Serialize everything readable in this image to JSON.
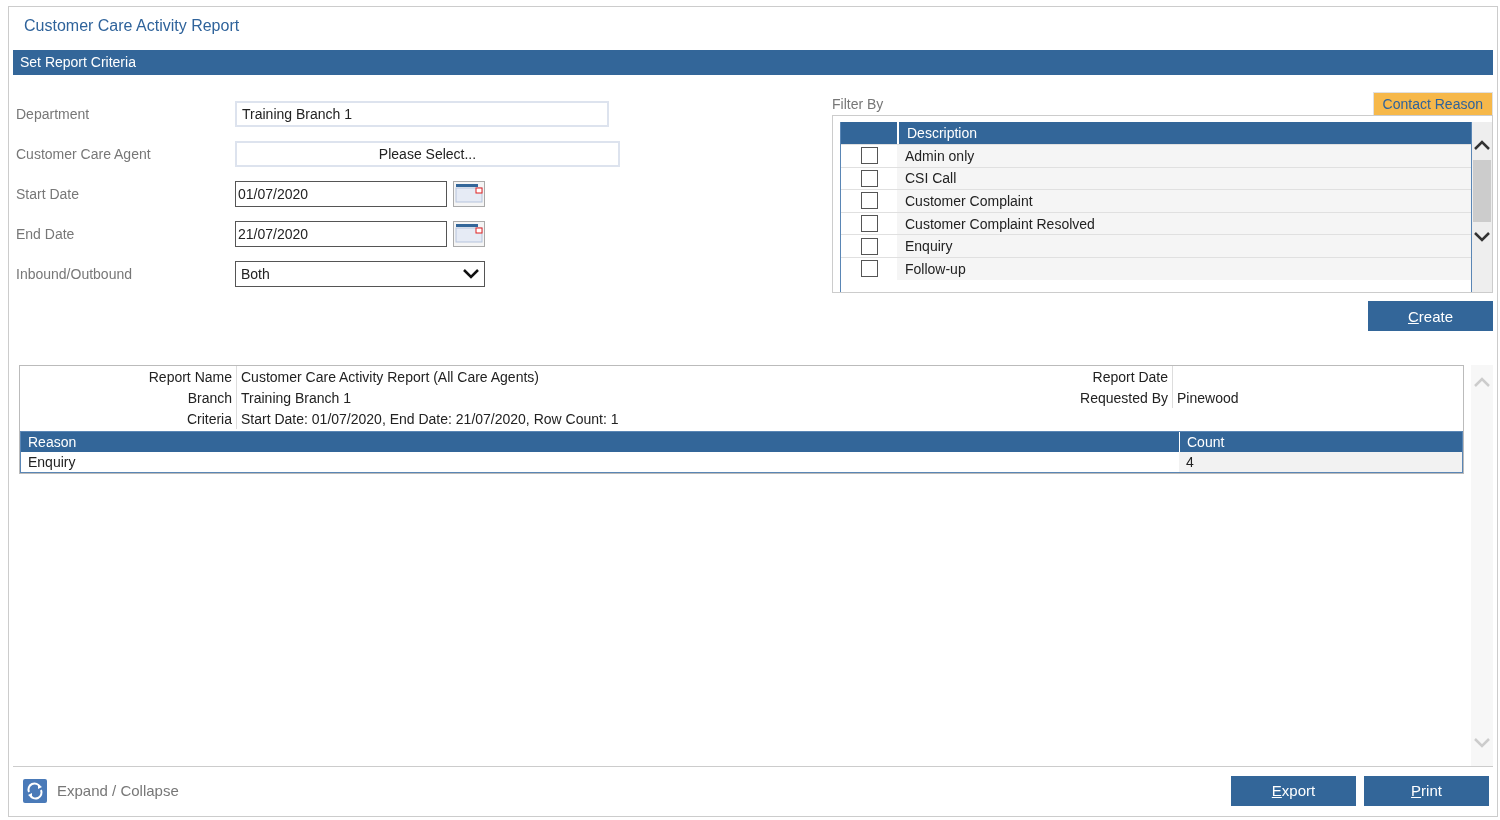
{
  "title": "Customer Care Activity Report",
  "criteria_header": "Set Report Criteria",
  "form": [
    {
      "kind": "text",
      "label": "Department",
      "value": "Training Branch 1"
    },
    {
      "kind": "picker",
      "label": "Customer Care Agent",
      "value": "Please Select..."
    },
    {
      "kind": "date",
      "label": "Start Date",
      "value": "01/07/2020"
    },
    {
      "kind": "date",
      "label": "End Date",
      "value": "21/07/2020"
    },
    {
      "kind": "select",
      "label": "Inbound/Outbound",
      "value": "Both"
    }
  ],
  "filter": {
    "label": "Filter By",
    "tab": "Contact Reason",
    "column": "Description",
    "items": [
      {
        "label": "Admin only",
        "checked": false
      },
      {
        "label": "CSI Call",
        "checked": false
      },
      {
        "label": "Customer Complaint",
        "checked": false
      },
      {
        "label": "Customer Complaint Resolved",
        "checked": false
      },
      {
        "label": "Enquiry",
        "checked": false
      },
      {
        "label": "Follow-up",
        "checked": false
      }
    ]
  },
  "create_button": "Create",
  "report": {
    "info_left": [
      {
        "label": "Report Name",
        "value": "Customer Care Activity Report (All Care Agents)"
      },
      {
        "label": "Branch",
        "value": "Training Branch 1"
      },
      {
        "label": "Criteria",
        "value": "Start Date: 01/07/2020, End Date: 21/07/2020, Row Count: 1"
      }
    ],
    "info_right": [
      {
        "label": "Report Date"
      },
      {
        "label": "Requested By",
        "value": "Pinewood"
      }
    ],
    "columns": [
      "Reason",
      "Count"
    ],
    "rows": [
      [
        "Enquiry",
        "4"
      ]
    ]
  },
  "footer": {
    "toggle": "Expand / Collapse",
    "buttons": [
      "Export",
      "Print"
    ]
  }
}
